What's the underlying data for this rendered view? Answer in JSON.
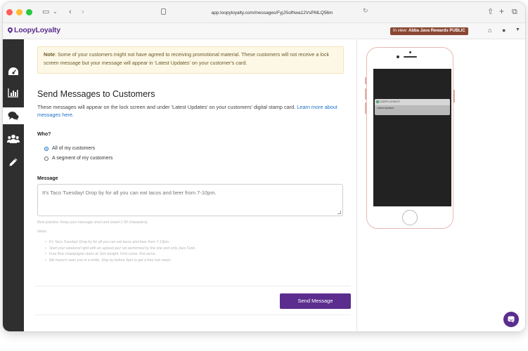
{
  "browser": {
    "url": "app.loopyloyalty.com/messages/FyjJSofhwa12VsPMLQ56m"
  },
  "header": {
    "logo": "LoopyLoyalty",
    "in_view_prefix": "In view:",
    "in_view_value": "Abba Java Rewards PUBLIC"
  },
  "sidebar": {
    "items": [
      {
        "icon": "dashboard-gauge-icon",
        "active": false
      },
      {
        "icon": "bar-chart-icon",
        "active": false
      },
      {
        "icon": "chat-bubbles-icon",
        "active": true
      },
      {
        "icon": "customers-group-icon",
        "active": false
      },
      {
        "icon": "pencil-icon",
        "active": false
      }
    ]
  },
  "note": {
    "label": "Note",
    "text": ": Some of your customers might not have agreed to receiving promotional material. These customers will not receive a lock screen message but your message will appear in 'Latest Updates' on your customer's card."
  },
  "main": {
    "title": "Send Messages to Customers",
    "description": "These messages will appear on the lock screen and under 'Latest Updates' on your customers' digital stamp card.",
    "learn_more": "Learn more about messages here.",
    "who_label": "Who?",
    "radio_all": "All of my customers",
    "radio_segment": "A segment of my customers",
    "message_label": "Message",
    "message_placeholder": "It's Taco Tuesday! Drop by for all you can eat tacos and beer from 7-10pm.",
    "best_practice": "Best practice: Keep your message short and sweet (~90 characters).",
    "ideas_label": "Ideas:",
    "ideas": [
      "It's Taco Tuesday! Drop by for all you can eat tacos and beer from 7-10pm.",
      "Start your weekend right with an upbeat jazz set performed by the one and only Jazz Funk.",
      "Free flow champagne starts at 7pm tonight. First come, first serve.",
      "We haven't seen you in a while. Stop by before 5pm to get a free hair wash."
    ],
    "send_button": "Send Message"
  },
  "preview": {
    "app_name": "LOOPY LOYALTY",
    "notif_text": "Latest Updates"
  },
  "colors": {
    "brand_purple": "#5b2d8e",
    "sidebar_bg": "#2f2f2f",
    "in_view_badge": "#8a4632",
    "link": "#1a73c8"
  }
}
